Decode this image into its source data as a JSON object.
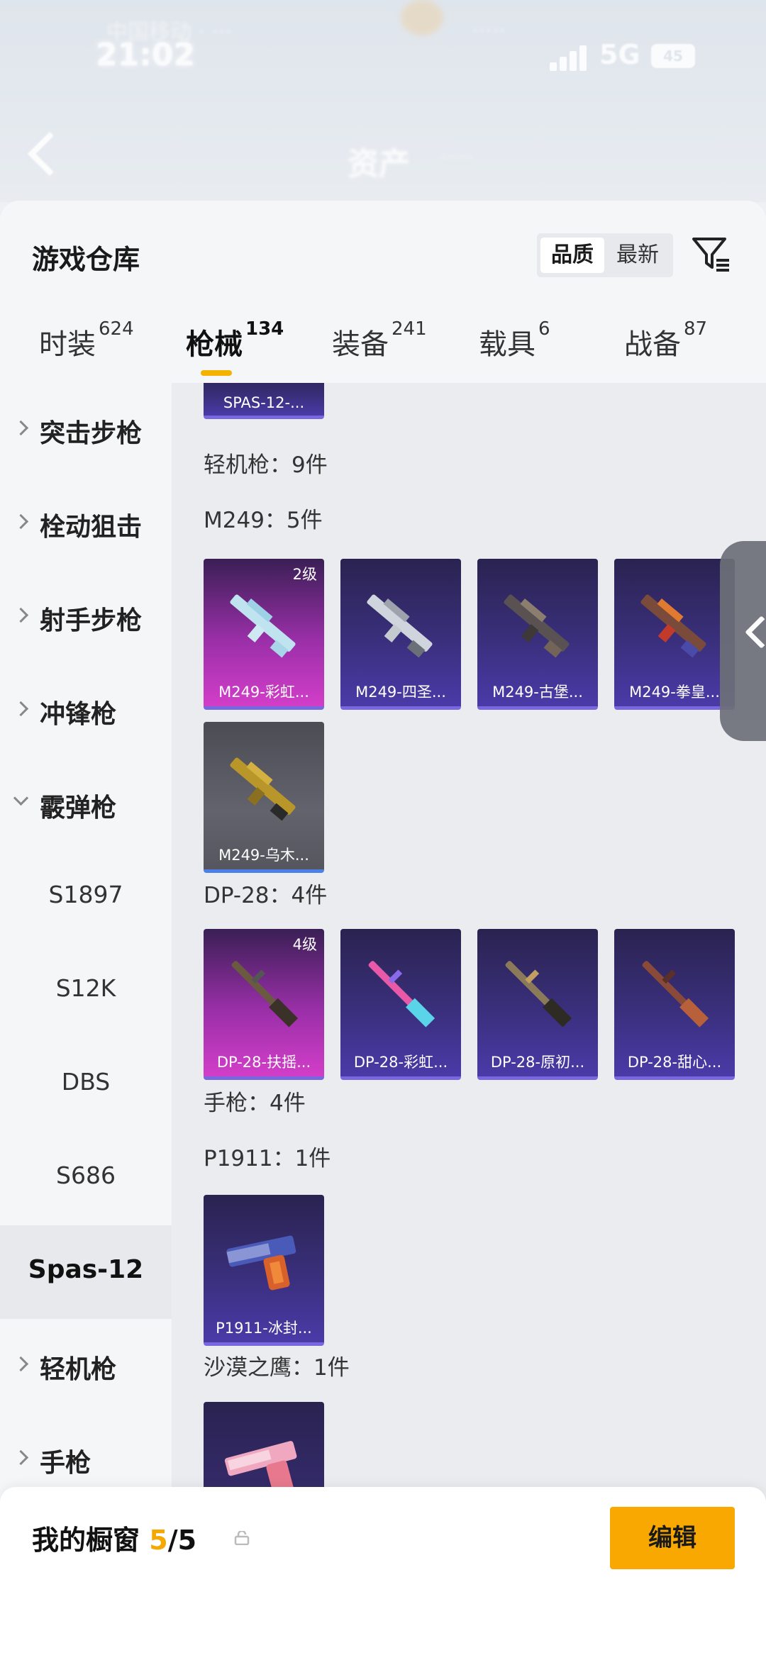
{
  "status_bar": {
    "time": "21:02",
    "network": "5G",
    "battery": "45",
    "blurred_left": "中国移动 · ···",
    "blurred_right": "·····"
  },
  "nav": {
    "title": "资产",
    "blurred_sub": "·····"
  },
  "header": {
    "title": "游戏仓库",
    "sort_options": [
      "品质",
      "最新"
    ],
    "sort_selected": "品质"
  },
  "tabs": [
    {
      "label": "时装",
      "count": "624"
    },
    {
      "label": "枪械",
      "count": "134"
    },
    {
      "label": "装备",
      "count": "241"
    },
    {
      "label": "载具",
      "count": "6"
    },
    {
      "label": "战备",
      "count": "87"
    }
  ],
  "active_tab": "枪械",
  "sidebar": {
    "items": [
      {
        "label": "突击步枪"
      },
      {
        "label": "栓动狙击"
      },
      {
        "label": "射手步枪"
      },
      {
        "label": "冲锋枪"
      },
      {
        "label": "霰弹枪"
      },
      {
        "label": "S1897"
      },
      {
        "label": "S12K"
      },
      {
        "label": "DBS"
      },
      {
        "label": "S686"
      },
      {
        "label": "Spas-12"
      },
      {
        "label": "轻机枪"
      },
      {
        "label": "手枪"
      }
    ],
    "selected": "Spas-12"
  },
  "content": {
    "top_cut_card": "SPAS-12-...",
    "sections": [
      {
        "heading": "轻机枪：9件"
      },
      {
        "heading": "M249：5件"
      },
      {
        "heading": "DP-28：4件"
      },
      {
        "heading": "手枪：4件"
      },
      {
        "heading": "P1911：1件"
      },
      {
        "heading": "沙漠之鹰：1件"
      }
    ],
    "m249_cards": [
      {
        "name": "M249-彩虹...",
        "level": "2级"
      },
      {
        "name": "M249-四圣..."
      },
      {
        "name": "M249-古堡..."
      },
      {
        "name": "M249-拳皇..."
      },
      {
        "name": "M249-乌木..."
      }
    ],
    "dp28_cards": [
      {
        "name": "DP-28-扶摇...",
        "level": "4级"
      },
      {
        "name": "DP-28-彩虹..."
      },
      {
        "name": "DP-28-原初..."
      },
      {
        "name": "DP-28-甜心..."
      }
    ],
    "p1911_cards": [
      {
        "name": "P1911-冰封..."
      }
    ]
  },
  "bottom": {
    "title": "我的橱窗",
    "count_used": "5",
    "count_sep_total": "/5",
    "edit_label": "编辑"
  },
  "colors": {
    "accent": "#f8a800",
    "card_purple": "#3a2f7c",
    "card_pink": "#d23ec8",
    "card_grey": "#62636c"
  }
}
